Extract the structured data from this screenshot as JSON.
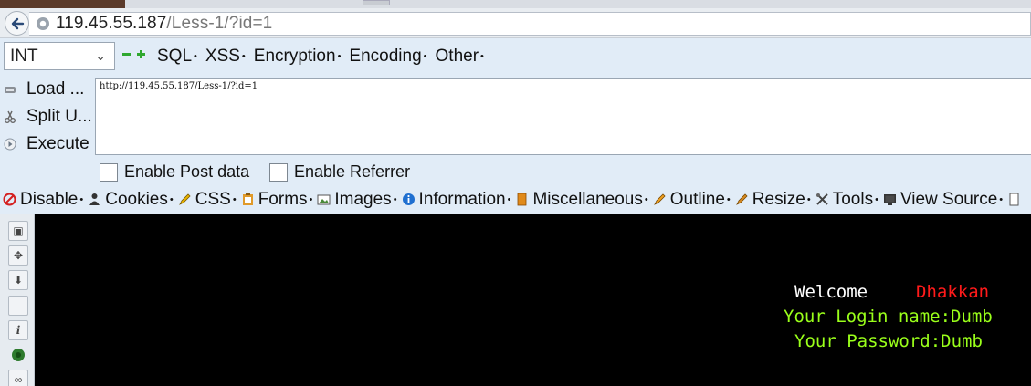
{
  "browser": {
    "address": {
      "host": "119.45.55.187",
      "path": "/Less-1/?id=1"
    }
  },
  "hackbar": {
    "select_value": "INT",
    "menus": [
      "SQL",
      "XSS",
      "Encryption",
      "Encoding",
      "Other"
    ],
    "actions": {
      "load": "Load ...",
      "split": "Split U...",
      "execute": "Execute"
    },
    "payload": "http://119.45.55.187/Less-1/?id=1",
    "enable_post": "Enable Post data",
    "enable_referrer": "Enable Referrer"
  },
  "webdev": {
    "items": [
      "Disable",
      "Cookies",
      "CSS",
      "Forms",
      "Images",
      "Information",
      "Miscellaneous",
      "Outline",
      "Resize",
      "Tools",
      "View Source"
    ]
  },
  "page": {
    "welcome": "Welcome",
    "name": "Dhakkan",
    "login_line": "Your Login name:Dumb",
    "password_line": "Your Password:Dumb"
  },
  "colors": {
    "toolbar_bg": "#e1ecf7",
    "content_bg": "#000000",
    "welcome_color": "#ffffff",
    "name_color": "#ff1a1a",
    "result_color": "#9aff1a"
  }
}
